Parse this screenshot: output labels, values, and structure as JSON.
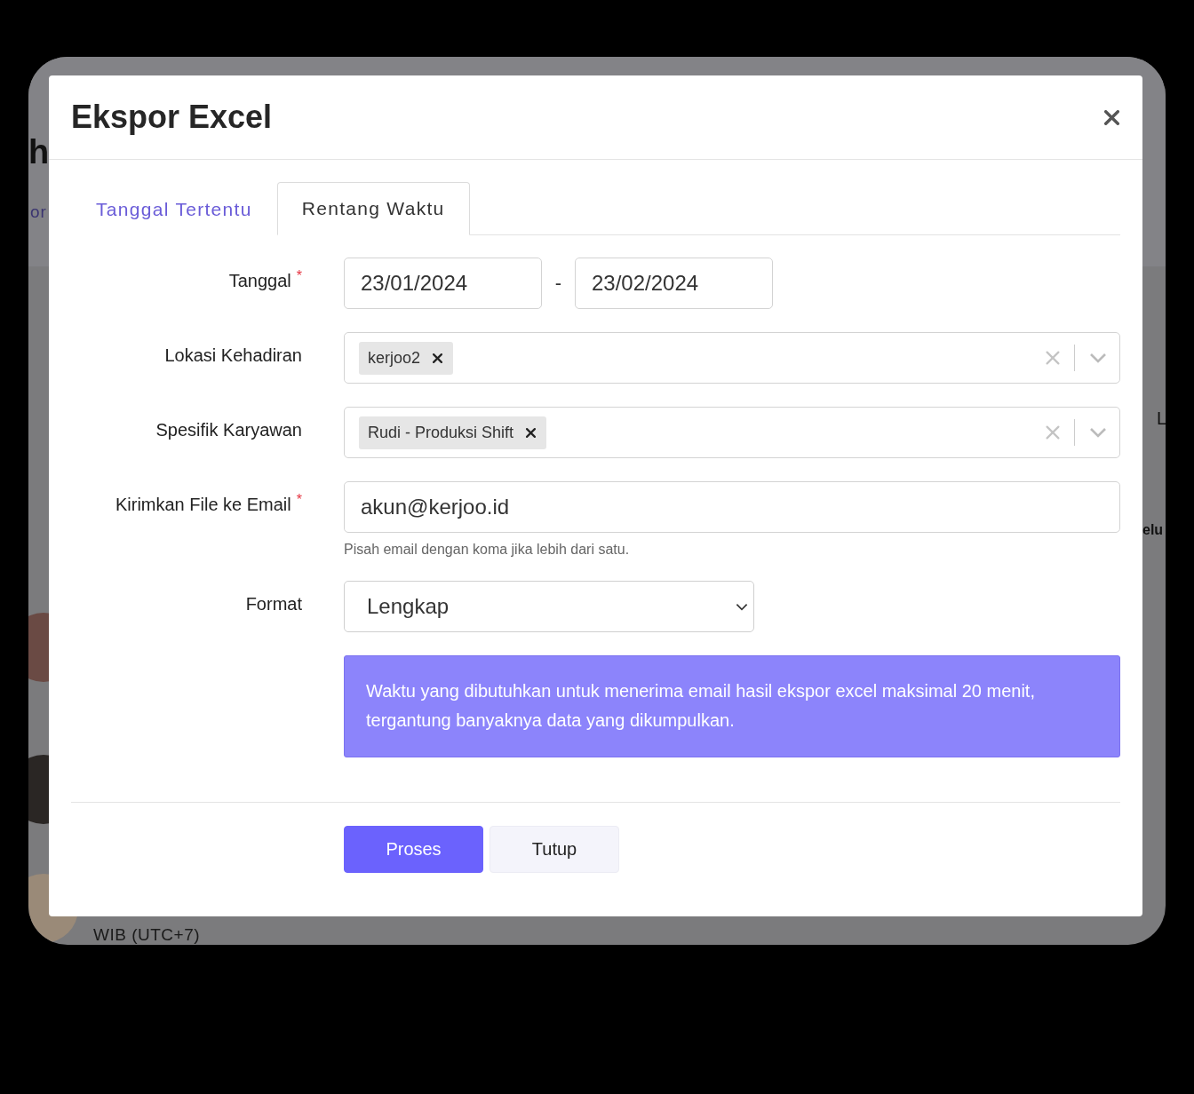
{
  "background": {
    "fragments": [
      {
        "kind": "heading",
        "text": "h"
      },
      {
        "kind": "link",
        "text": "or"
      },
      {
        "kind": "cell",
        "text": "L"
      },
      {
        "kind": "bold",
        "text": "elu"
      }
    ],
    "avatars": [
      {
        "color": "#6a4a44"
      },
      {
        "color": "#2a2624"
      },
      {
        "color": "#9a8a78"
      }
    ],
    "footer_text": "WIB (UTC+7)"
  },
  "modal": {
    "title": "Ekspor Excel",
    "tabs": [
      {
        "label": "Tanggal Tertentu",
        "selected": false
      },
      {
        "label": "Rentang Waktu",
        "selected": true
      }
    ],
    "fields": [
      {
        "kind": "date_range",
        "label": "Tanggal",
        "required_mark": "*",
        "start": "23/01/2024",
        "separator": "-",
        "end": "23/02/2024"
      },
      {
        "kind": "multiselect",
        "label": "Lokasi Kehadiran",
        "tags": [
          "kerjoo2"
        ]
      },
      {
        "kind": "multiselect",
        "label": "Spesifik Karyawan",
        "tags": [
          "Rudi - Produksi Shift"
        ]
      },
      {
        "kind": "text",
        "label": "Kirimkan File ke Email",
        "required_mark": "*",
        "value": "akun@kerjoo.id",
        "help": "Pisah email dengan koma jika lebih dari satu."
      },
      {
        "kind": "select",
        "label": "Format",
        "value": "Lengkap"
      }
    ],
    "notice": "Waktu yang dibutuhkan untuk menerima email hasil ekspor excel maksimal 20 menit, tergantung banyaknya data yang dikumpulkan.",
    "buttons": [
      {
        "kind": "primary",
        "label": "Proses"
      },
      {
        "kind": "secondary",
        "label": "Tutup"
      }
    ]
  }
}
